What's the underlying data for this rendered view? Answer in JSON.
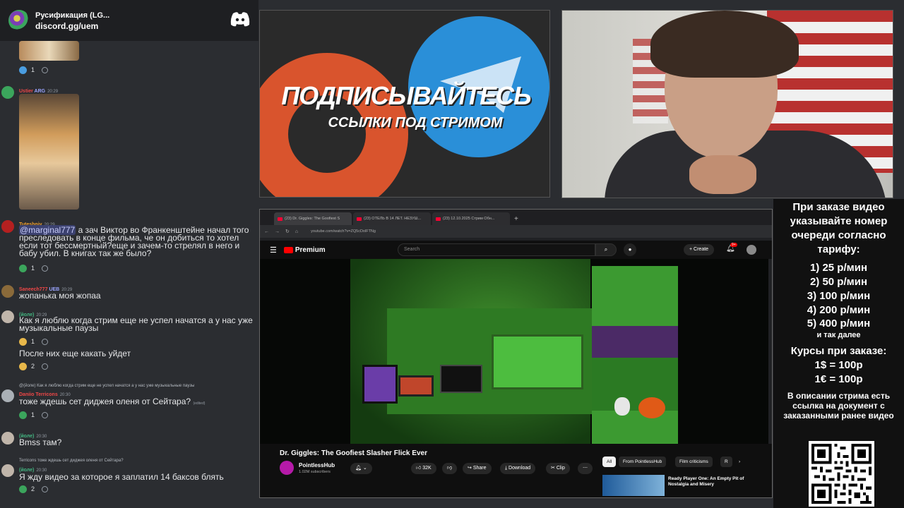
{
  "discord": {
    "server_name": "Русификация (LG...",
    "invite": "discord.gg/uem",
    "messages": [
      {
        "user": "",
        "time": "",
        "text": "",
        "reaction": "1"
      },
      {
        "user": "Ustier",
        "badge": "ARG",
        "time": "20:29",
        "text": "",
        "reaction": ""
      },
      {
        "user": "Tuteshniy",
        "time": "20:29",
        "mention": "@marginal777",
        "text": " а зач  Виктор во Франкенштейне начал того преследовать в конце фильма, че он добиться то хотел если тот бессмертный?еще и зачем-то стрелял в него и бабу убил. В книгах так же было?",
        "reaction": "1"
      },
      {
        "user": "Saneech777",
        "badge": "UEB",
        "time": "20:29",
        "text": "жопанька моя жопаа",
        "reaction": ""
      },
      {
        "user": "(йоле)",
        "time": "20:29",
        "text": "Как я люблю когда стрим еще не успел начатся а у нас уже музыкальные паузы",
        "reaction": "1"
      },
      {
        "user": "",
        "time": "",
        "text": "После них еще какать уйдет",
        "reaction": "2"
      },
      {
        "reply": "@(йоле) Как я люблю когда стрим еще не успел начатся а у нас уже музыкальные паузы",
        "user": "Daniio Terricons",
        "time": "20:30",
        "text": "тоже ждешь сет диджея оленя от Сейтара?",
        "edited": "(edited)",
        "reaction": "1"
      },
      {
        "user": "(йоле)",
        "time": "20:30",
        "text": "Bmss там?",
        "reaction": ""
      },
      {
        "reply": "Terricons тоже ждешь сет диджея оленя от Сейтара?",
        "user": "(йоле)",
        "time": "20:30",
        "text": "Я жду видео за которое я заплатил 14 баксов блять",
        "reaction": "2"
      }
    ]
  },
  "promo": {
    "line1": "ПОДПИСЫВАЙТЕСЬ",
    "line2": "ССЫЛКИ ПОД СТРИМОМ"
  },
  "sidebar": {
    "intro": "При заказе видео указывайте номер очереди согласно тарифу:",
    "tariffs": [
      "1) 25 р/мин",
      "2) 50 р/мин",
      "3) 100 р/мин",
      "4) 200 р/мин",
      "5) 400 р/мин"
    ],
    "etc": "и так далее",
    "courses_title": "Курсы при заказе:",
    "courses": [
      "1$ = 100р",
      "1€ = 100р"
    ],
    "desc": "В описании стрима есть ссылка на документ с заказанными ранее видео"
  },
  "browser": {
    "tabs": [
      "(23) Dr. Giggles: The Goofiest S",
      "(23) ОТЕЛЬ В 14 ЛЕТ. НЕЗУШ...",
      "(23) 12.10.2025 Стрим Обн..."
    ],
    "url": "youtube.com/watch?v=ZQ5cDolFTNg"
  },
  "youtube": {
    "brand": "Premium",
    "search_placeholder": "Search",
    "create": "Create",
    "notifications": "9+",
    "video_title": "Dr. Giggles: The Goofiest Slasher Flick Ever",
    "channel": "PointlessHub",
    "subscribers": "1.02M subscribers",
    "likes": "32K",
    "share": "Share",
    "download": "Download",
    "clip": "Clip",
    "chips": [
      "All",
      "From PointlessHub",
      "Film criticisms",
      "R"
    ],
    "rec_title": "Ready Player One: An Empty Pit of Nostalgia and Misery"
  },
  "colors": {
    "discord_bg": "#2b2d31",
    "yt_red": "#ff0000",
    "promo_red": "#d9542d",
    "promo_blue": "#2a8fd8"
  }
}
